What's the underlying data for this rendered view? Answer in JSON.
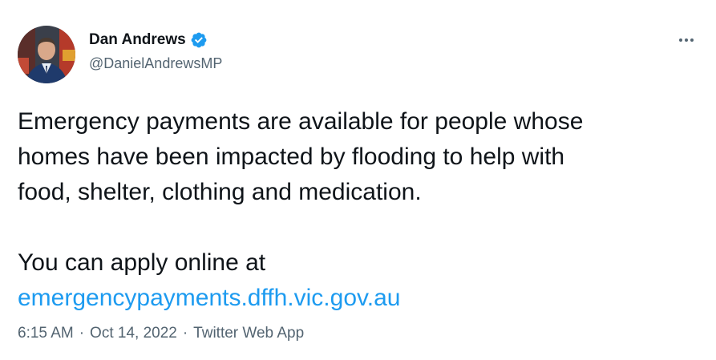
{
  "author": {
    "display_name": "Dan Andrews",
    "handle": "@DanielAndrewsMP",
    "verified": true,
    "verified_color": "#1d9bf0"
  },
  "tweet": {
    "line1": "Emergency payments are available for people whose",
    "line2": "homes have been impacted by flooding to help with",
    "line3": "food, shelter, clothing and medication.",
    "line4": "You can apply online at",
    "link": "emergencypayments.dffh.vic.gov.au"
  },
  "meta": {
    "time": "6:15 AM",
    "date": "Oct 14, 2022",
    "source": "Twitter Web App",
    "separator": "·"
  },
  "icons": {
    "more": "more-horizontal-icon",
    "verified": "verified-badge-icon"
  },
  "colors": {
    "text": "#0f1419",
    "secondary": "#536471",
    "link": "#1d9bf0"
  }
}
